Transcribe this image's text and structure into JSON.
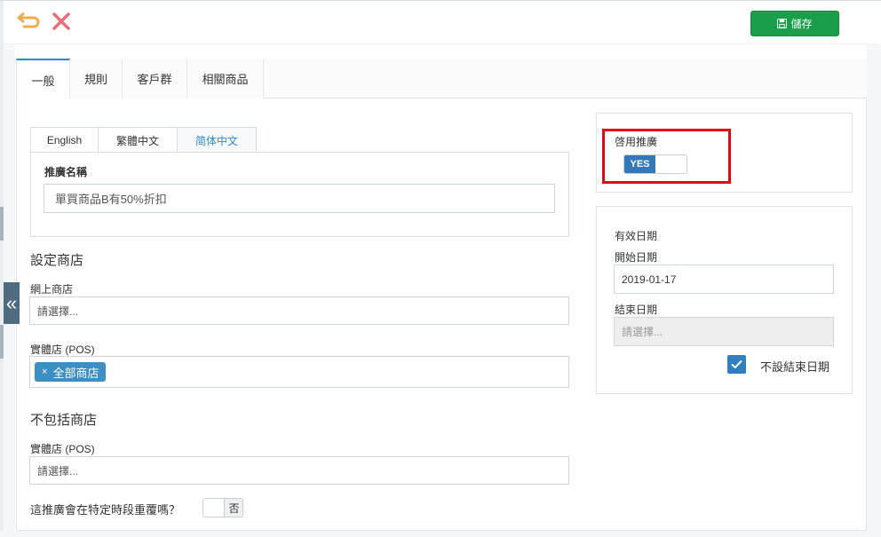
{
  "header": {
    "save_label": "儲存"
  },
  "tabs": [
    {
      "label": "一般"
    },
    {
      "label": "規則"
    },
    {
      "label": "客戶群"
    },
    {
      "label": "相關商品"
    }
  ],
  "lang_tabs": [
    {
      "label": "English"
    },
    {
      "label": "繁體中文"
    },
    {
      "label": "简体中文"
    }
  ],
  "promo_name": {
    "label": "推廣名稱",
    "value": "單買商品B有50%折扣"
  },
  "set_store": {
    "title": "設定商店",
    "online_label": "網上商店",
    "online_placeholder": "請選擇...",
    "pos_label": "實體店 (POS)",
    "pos_chip_x": "×",
    "pos_chip": "全部商店"
  },
  "exclude_store": {
    "title": "不包括商店",
    "pos_label": "實體店 (POS)",
    "pos_placeholder": "請選擇..."
  },
  "repeat": {
    "question": "這推廣會在特定時段重覆嗎？",
    "toggle_label": "否"
  },
  "enable": {
    "label": "啓用推廣",
    "toggle_label": "YES"
  },
  "valid": {
    "title": "有效日期",
    "start_label": "開始日期",
    "start_value": "2019-01-17",
    "end_label": "結束日期",
    "end_placeholder": "請選擇...",
    "no_end_label": "不設結束日期"
  },
  "sidebar_handle": "«",
  "colors": {
    "save_green": "#1a9e4b",
    "accent_blue": "#2e8bc9",
    "highlight_red": "#e30613",
    "undo_orange": "#f0ad4e",
    "close_red": "#e8707a"
  }
}
